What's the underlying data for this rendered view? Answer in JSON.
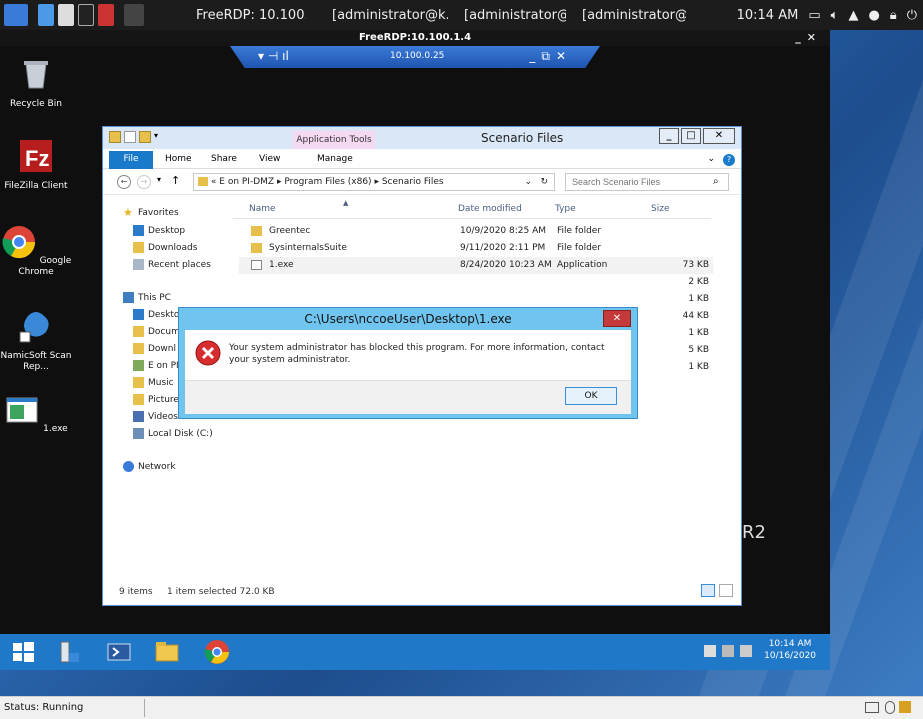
{
  "host_panel": {
    "title": "FreeRDP: 10.100....",
    "tasks": [
      "[administrator@k...",
      "[administrator@k...",
      "[administrator@k..."
    ],
    "clock": "10:14 AM"
  },
  "rdp_window": {
    "title": "FreeRDP:10.100.1.4",
    "connection_bar_ip": "10.100.0.25"
  },
  "desktop_icons": [
    {
      "label": "Recycle Bin",
      "icon": "recycle-bin-icon"
    },
    {
      "label": "FileZilla Client",
      "icon": "filezilla-icon"
    },
    {
      "label": "Google Chrome",
      "icon": "chrome-icon"
    },
    {
      "label": "NamicSoft Scan Rep...",
      "icon": "namicsoft-icon"
    },
    {
      "label": "1.exe",
      "icon": "application-icon"
    }
  ],
  "explorer": {
    "title": "Scenario Files",
    "contextual_tab": "Application Tools",
    "ribbon_tabs": [
      "File",
      "Home",
      "Share",
      "View",
      "Manage"
    ],
    "address": {
      "prefix": "«",
      "segments": [
        "E on PI-DMZ",
        "Program Files (x86)",
        "Scenario Files"
      ]
    },
    "search_placeholder": "Search Scenario Files",
    "nav_pane": [
      {
        "label": "Favorites",
        "type": "star"
      },
      {
        "label": "Desktop",
        "type": "desktop"
      },
      {
        "label": "Downloads",
        "type": "downloads"
      },
      {
        "label": "Recent places",
        "type": "recent"
      },
      {
        "label": "This PC",
        "type": "pc"
      },
      {
        "label": "Deskto",
        "type": "desktop"
      },
      {
        "label": "Docum",
        "type": "documents"
      },
      {
        "label": "Downl",
        "type": "downloads"
      },
      {
        "label": "E on PI",
        "type": "network-drive"
      },
      {
        "label": "Music",
        "type": "music"
      },
      {
        "label": "Pictures",
        "type": "pictures"
      },
      {
        "label": "Videos",
        "type": "videos"
      },
      {
        "label": "Local Disk (C:)",
        "type": "disk"
      },
      {
        "label": "Network",
        "type": "network"
      }
    ],
    "columns": {
      "name": "Name",
      "date": "Date modified",
      "type": "Type",
      "size": "Size"
    },
    "files": [
      {
        "name": "Greentec",
        "date": "10/9/2020 8:25 AM",
        "type": "File folder",
        "size": ""
      },
      {
        "name": "SysinternalsSuite",
        "date": "9/11/2020 2:11 PM",
        "type": "File folder",
        "size": ""
      },
      {
        "name": "1.exe",
        "date": "8/24/2020 10:23 AM",
        "type": "Application",
        "size": "73 KB"
      }
    ],
    "hidden_sizes": [
      "2 KB",
      "1 KB",
      "44 KB",
      "1 KB",
      "5 KB",
      "1 KB"
    ],
    "status": {
      "count": "9 items",
      "selected": "1 item selected  72.0 KB"
    }
  },
  "dialog": {
    "title": "C:\\Users\\nccoeUser\\Desktop\\1.exe",
    "message": "Your system administrator has blocked this program. For more information, contact your system administrator.",
    "ok_label": "OK"
  },
  "remote_taskbar": {
    "time": "10:14 AM",
    "date": "10/16/2020"
  },
  "wallpaper_fragment": "R2",
  "outer_status": "Status: Running",
  "colors": {
    "accent": "#1979ca",
    "dialog_frame": "#6fc5f0",
    "error_red": "#c43a3a",
    "taskbar": "#1f78c8"
  }
}
